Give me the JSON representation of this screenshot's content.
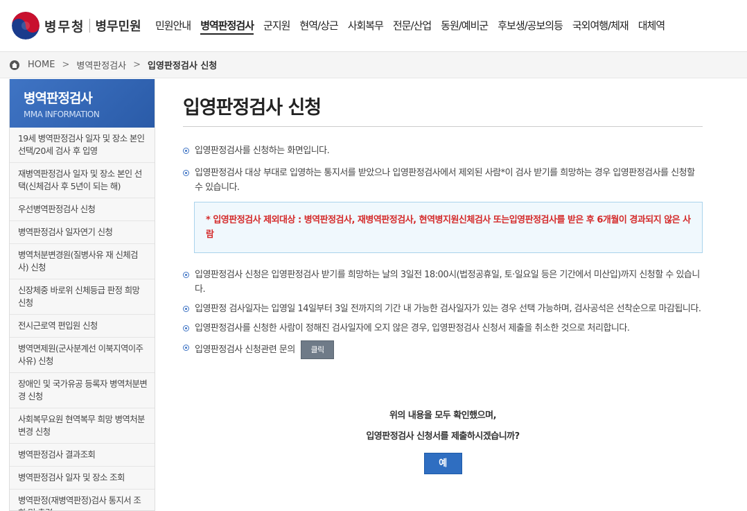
{
  "logo": {
    "name": "병무청",
    "sub": "병무민원"
  },
  "gnb": [
    "민원안내",
    "병역판정검사",
    "군지원",
    "현역/상근",
    "사회복무",
    "전문/산업",
    "동원/예비군",
    "후보생/공보의등",
    "국외여행/체재",
    "대체역"
  ],
  "breadcrumb": {
    "home": "HOME",
    "level1": "병역판정검사",
    "current": "입영판정검사 신청",
    "sep": ">"
  },
  "sidebar": {
    "title": "병역판정검사",
    "subtitle": "MMA INFORMATION",
    "items": [
      "19세 병역판정검사 일자 및 장소 본인선택/20세 검사 후 입영",
      "재병역판정검사 일자 및 장소 본인 선택(신체검사 후 5년이 되는 해)",
      "우선병역판정검사 신청",
      "병역판정검사 일자연기 신청",
      "병역처분변경원(질병사유 재 신체검사) 신청",
      "신장체중 바로위 신체등급 판정 희망 신청",
      "전시근로역 편입원 신청",
      "병역면제원(군사분계선 이북지역이주사유) 신청",
      "장애인 및 국가유공 등록자 병역처분변경 신청",
      "사회복무요원 현역복무 희망 병역처분변경 신청",
      "병역판정검사 결과조회",
      "병역판정검사 일자 및 장소 조회",
      "병역판정(재병역판정)검사 통지서 조회 및 출력"
    ]
  },
  "main": {
    "title": "입영판정검사 신청",
    "bullets_top": [
      "입영판정검사를 신청하는 화면입니다.",
      "입영판정검사 대상 부대로 입영하는 통지서를 받았으나 입영판정검사에서 제외된 사람*이 검사 받기를 희망하는 경우 입영판정검사를 신청할 수 있습니다."
    ],
    "notice": "* 입영판정검사 제외대상 : 병역판정검사, 재병역판정검사, 현역병지원신체검사 또는입영판정검사를 받은 후 6개월이 경과되지 않은 사람",
    "bullets_bottom": [
      "입영판정검사 신청은 입영판정검사 받기를 희망하는 날의 3일전 18:00시(법정공휴일, 토·일요일 등은 기간에서 미산입)까지 신청할 수 있습니다.",
      "입영판정 검사일자는 입영일 14일부터 3일 전까지의 기간 내 가능한 검사일자가 있는 경우 선택 가능하며, 검사공석은 선착순으로 마감됩니다.",
      "입영판정검사를 신청한 사람이 정해진 검사일자에 오지 않은 경우, 입영판정검사 신청서 제출을 취소한 것으로 처리합니다."
    ],
    "inquiry_label": "입영판정검사 신청관련 문의",
    "inquiry_button": "클릭",
    "confirm_line1": "위의 내용을 모두 확인했으며,",
    "confirm_line2": "입영판정검사 신청서를 제출하시겠습니까?",
    "yes_button": "예"
  },
  "colors": {
    "accent": "#2f6ec1",
    "notice_text": "#d42a2a"
  }
}
